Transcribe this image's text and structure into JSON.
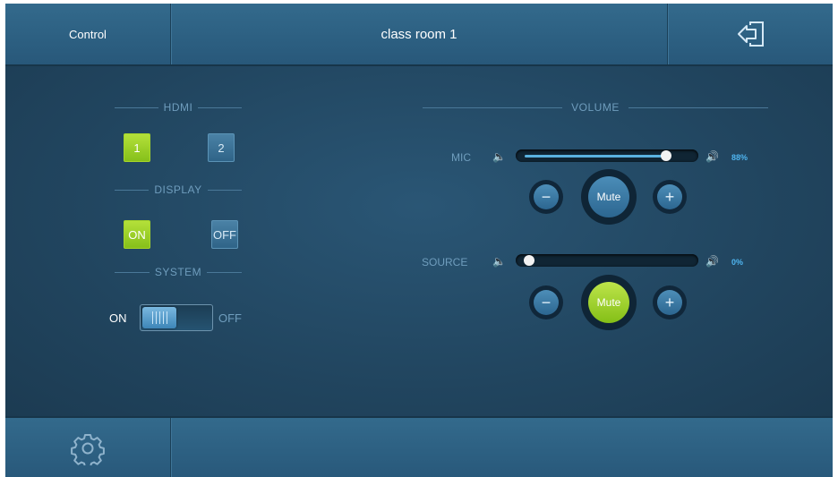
{
  "header": {
    "left_label": "Control",
    "title": "class room 1",
    "exit_icon": "exit-icon"
  },
  "hdmi": {
    "title": "HDMI",
    "buttons": [
      "1",
      "2"
    ],
    "selected": "1"
  },
  "display": {
    "title": "DISPLAY",
    "on_label": "ON",
    "off_label": "OFF",
    "selected": "ON"
  },
  "system": {
    "title": "SYSTEM",
    "on_label": "ON",
    "off_label": "OFF",
    "state": "ON"
  },
  "volume": {
    "title": "VOLUME",
    "mic": {
      "label": "MIC",
      "percent_text": "88%",
      "level": 0.88,
      "minus": "−",
      "plus": "+",
      "mute_label": "Mute",
      "muted": false
    },
    "source": {
      "label": "SOURCE",
      "percent_text": "0%",
      "level": 0.0,
      "minus": "−",
      "plus": "+",
      "mute_label": "Mute",
      "muted": true
    }
  },
  "footer": {
    "settings_icon": "gear-icon"
  },
  "colors": {
    "accent_green": "#9acd32",
    "accent_blue": "#4fb5f0",
    "panel_bg": "#21445e"
  }
}
